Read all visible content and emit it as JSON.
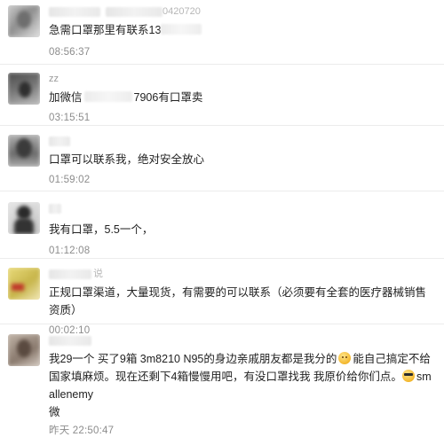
{
  "comments": [
    {
      "username_suffix": "0420720",
      "text_pre": "急需口罩那里有联系13",
      "text_post": "",
      "time": "08:56:37"
    },
    {
      "username": "zz",
      "text_pre": "加微信",
      "text_post": "7906有口罩卖",
      "time": "03:15:51"
    },
    {
      "text": "口罩可以联系我，绝对安全放心",
      "time": "01:59:02"
    },
    {
      "text": "我有口罩，5.5一个，",
      "time": "01:12:08"
    },
    {
      "username_suffix": "说",
      "text": "正规口罩渠道，大量现货，有需要的可以联系（必须要有全套的医疗器械销售资质）",
      "time": "00:02:10"
    },
    {
      "text_part1": "我29一个 买了9箱 3m8210 N95的身边亲戚朋友都是我分的",
      "text_part2": "能自己搞定不给国家填麻烦。现在还剩下4箱慢慢用吧，有没口罩找我 我原价给你们点。",
      "text_part3": "smallenemy",
      "text_part4": "微",
      "time": "昨天 22:50:47",
      "emoji_1": "smirk-emoji",
      "emoji_2": "cool-emoji"
    }
  ]
}
